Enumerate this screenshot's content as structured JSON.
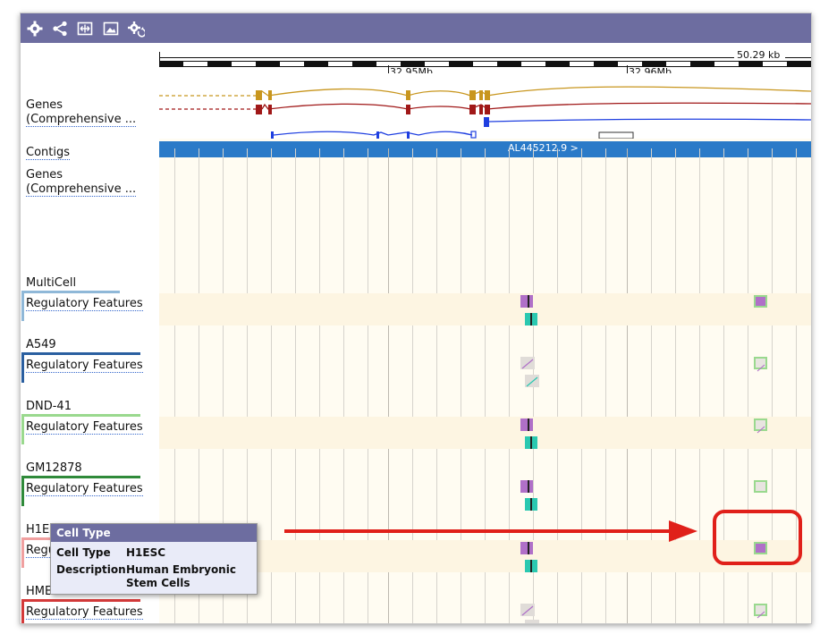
{
  "toolbar": {
    "icons": [
      "settings-icon",
      "share-icon",
      "resize-icon",
      "export-image-icon",
      "reset-config-icon"
    ],
    "background": "#6d6da0"
  },
  "ruler": {
    "length_label": "50.29 kb",
    "ticks": [
      "32.95Mb",
      "32.96Mb"
    ]
  },
  "tracks": {
    "genes_label_1": "Genes",
    "genes_sublabel_1": "(Comprehensive ...",
    "contigs_label": "Contigs",
    "contig_name": "AL445212.9 >",
    "genes_label_2": "Genes",
    "genes_sublabel_2": "(Comprehensive ..."
  },
  "cell_types": [
    {
      "name": "MultiCell",
      "track": "Regulatory Features",
      "color": "#8fb8d8"
    },
    {
      "name": "A549",
      "track": "Regulatory Features",
      "color": "#2a5fa0"
    },
    {
      "name": "DND-41",
      "track": "Regulatory Features",
      "color": "#9ad98e"
    },
    {
      "name": "GM12878",
      "track": "Regulatory Features",
      "color": "#2f8a3a"
    },
    {
      "name": "H1ESC",
      "track": "Regulatory Features",
      "color": "#f0a0a0"
    },
    {
      "name": "HMEC",
      "track": "Regulatory Features",
      "color": "#d43a3a"
    }
  ],
  "tooltip": {
    "title": "Cell Type",
    "cell_type_label": "Cell Type",
    "cell_type_value": "H1ESC",
    "description_label": "Description",
    "description_value_line1": "Human Embryonic",
    "description_value_line2": "Stem Cells"
  },
  "colors": {
    "gene_gold": "#c8961e",
    "gene_red": "#a01818",
    "gene_blue": "#1f3fe0",
    "contig_blue": "#2a7ac8",
    "promoter_purple": "#b070c8",
    "ctcf_teal": "#2ac8b0",
    "annotation_red": "#e0201a"
  }
}
